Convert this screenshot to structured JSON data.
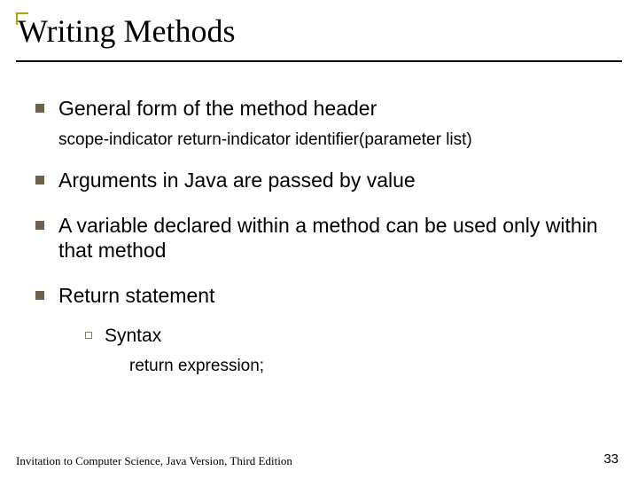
{
  "title": "Writing Methods",
  "bullets": [
    {
      "text": "General form of the method header",
      "sub": "scope-indicator return-indicator identifier(parameter list)"
    },
    {
      "text": "Arguments in Java are passed by value"
    },
    {
      "text": "A variable declared within a method can be used only within that method"
    },
    {
      "text": "Return statement",
      "nested": {
        "label": "Syntax",
        "sub": "return expression;"
      }
    }
  ],
  "footer": "Invitation to Computer Science, Java Version, Third Edition",
  "page": "33"
}
